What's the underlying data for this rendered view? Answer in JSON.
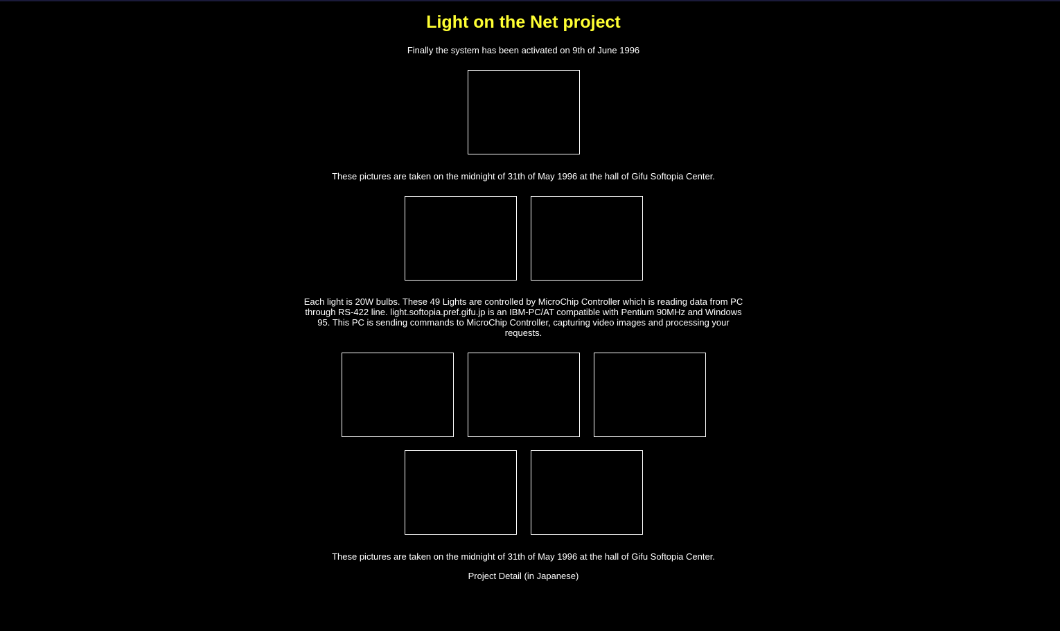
{
  "title": "Light on the Net project",
  "intro": "Finally the system has been activated on 9th of June 1996",
  "caption_top": "These pictures are taken on the midnight of 31th of May 1996 at the hall of Gifu Softopia Center.",
  "description": "Each light is 20W bulbs. These 49 Lights are controlled by MicroChip Controller which is reading data from PC through RS-422 line. light.softopia.pref.gifu.jp is an IBM-PC/AT compatible with Pentium 90MHz and Windows 95. This PC is sending commands to MicroChip Controller, capturing video images and processing your requests.",
  "caption_bottom": "These pictures are taken on the midnight of 31th of May 1996 at the hall of Gifu Softopia Center.",
  "project_detail_link": "Project Detail (in Japanese)",
  "colors": {
    "background": "#000000",
    "title": "#ffff33",
    "text": "#ffffff",
    "image_border": "#ffffff"
  }
}
